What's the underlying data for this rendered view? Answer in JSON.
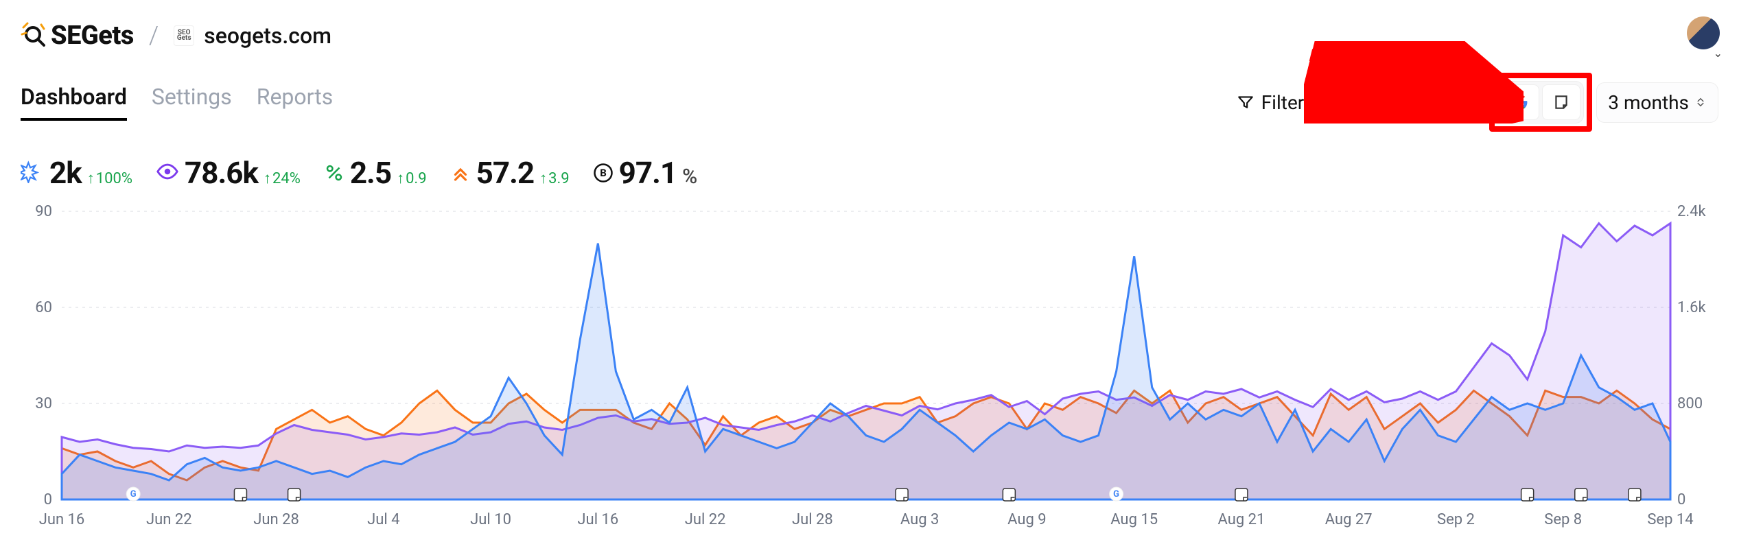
{
  "brand": {
    "name": "SEO Gets"
  },
  "site": {
    "domain": "seogets.com"
  },
  "tabs": [
    {
      "id": "dashboard",
      "label": "Dashboard",
      "active": true
    },
    {
      "id": "settings",
      "label": "Settings",
      "active": false
    },
    {
      "id": "reports",
      "label": "Reports",
      "active": false
    }
  ],
  "toolbar": {
    "filter_label": "Filter",
    "date_range": "3 months"
  },
  "stats": {
    "clicks": {
      "icon": "clicks",
      "value": "2k",
      "delta": "100%",
      "direction": "up"
    },
    "impressions": {
      "icon": "impressions",
      "value": "78.6k",
      "delta": "24%",
      "direction": "up"
    },
    "ctr": {
      "icon": "ctr",
      "value": "2.5",
      "delta": "0.9",
      "direction": "up"
    },
    "position": {
      "icon": "position",
      "value": "57.2",
      "delta": "3.9",
      "direction": "up"
    },
    "brand": {
      "icon": "brand",
      "value": "97.1",
      "suffix": "%"
    }
  },
  "annotations": {
    "highlight_group": "source-icons",
    "arrow_target": "source-icons"
  },
  "chart_data": {
    "type": "line",
    "xlabel": "",
    "ylabel_left": "",
    "ylabel_right": "",
    "ylim_left": [
      0,
      90
    ],
    "ylim_right": [
      0,
      2400
    ],
    "left_ticks": [
      0,
      30,
      60,
      90
    ],
    "right_ticks": [
      0,
      800,
      1600,
      2400
    ],
    "right_tick_labels": [
      "0",
      "800",
      "1.6k",
      "2.4k"
    ],
    "x_dates": [
      "Jun 16",
      "Jun 17",
      "Jun 18",
      "Jun 19",
      "Jun 20",
      "Jun 21",
      "Jun 22",
      "Jun 23",
      "Jun 24",
      "Jun 25",
      "Jun 26",
      "Jun 27",
      "Jun 28",
      "Jun 29",
      "Jun 30",
      "Jul 1",
      "Jul 2",
      "Jul 3",
      "Jul 4",
      "Jul 5",
      "Jul 6",
      "Jul 7",
      "Jul 8",
      "Jul 9",
      "Jul 10",
      "Jul 11",
      "Jul 12",
      "Jul 13",
      "Jul 14",
      "Jul 15",
      "Jul 16",
      "Jul 17",
      "Jul 18",
      "Jul 19",
      "Jul 20",
      "Jul 21",
      "Jul 22",
      "Jul 23",
      "Jul 24",
      "Jul 25",
      "Jul 26",
      "Jul 27",
      "Jul 28",
      "Jul 29",
      "Jul 30",
      "Jul 31",
      "Aug 1",
      "Aug 2",
      "Aug 3",
      "Aug 4",
      "Aug 5",
      "Aug 6",
      "Aug 7",
      "Aug 8",
      "Aug 9",
      "Aug 10",
      "Aug 11",
      "Aug 12",
      "Aug 13",
      "Aug 14",
      "Aug 15",
      "Aug 16",
      "Aug 17",
      "Aug 18",
      "Aug 19",
      "Aug 20",
      "Aug 21",
      "Aug 22",
      "Aug 23",
      "Aug 24",
      "Aug 25",
      "Aug 26",
      "Aug 27",
      "Aug 28",
      "Aug 29",
      "Aug 30",
      "Aug 31",
      "Sep 1",
      "Sep 2",
      "Sep 3",
      "Sep 4",
      "Sep 5",
      "Sep 6",
      "Sep 7",
      "Sep 8",
      "Sep 9",
      "Sep 10",
      "Sep 11",
      "Sep 12",
      "Sep 13",
      "Sep 14"
    ],
    "x_tick_labels": [
      "Jun 16",
      "Jun 22",
      "Jun 28",
      "Jul 4",
      "Jul 10",
      "Jul 16",
      "Jul 22",
      "Jul 28",
      "Aug 3",
      "Aug 9",
      "Aug 15",
      "Aug 21",
      "Aug 27",
      "Sep 2",
      "Sep 8",
      "Sep 14"
    ],
    "x_tick_idx": [
      0,
      6,
      12,
      18,
      24,
      30,
      36,
      42,
      48,
      54,
      60,
      66,
      72,
      78,
      84,
      90
    ],
    "series": [
      {
        "name": "clicks",
        "axis": "left",
        "color": "#3b82f6",
        "values": [
          8,
          14,
          12,
          10,
          9,
          8,
          6,
          11,
          13,
          10,
          9,
          10,
          12,
          10,
          8,
          9,
          7,
          10,
          12,
          11,
          14,
          16,
          18,
          22,
          26,
          38,
          30,
          20,
          14,
          50,
          80,
          40,
          25,
          28,
          24,
          35,
          15,
          22,
          20,
          18,
          16,
          18,
          24,
          30,
          26,
          20,
          18,
          22,
          28,
          24,
          20,
          15,
          20,
          24,
          22,
          25,
          20,
          18,
          20,
          40,
          76,
          35,
          25,
          30,
          25,
          28,
          26,
          30,
          18,
          28,
          15,
          22,
          18,
          25,
          12,
          22,
          28,
          20,
          18,
          25,
          32,
          28,
          30,
          28,
          30,
          45,
          35,
          32,
          28,
          30,
          18
        ]
      },
      {
        "name": "impressions",
        "axis": "right",
        "color": "#8b5cf6",
        "values": [
          520,
          480,
          500,
          460,
          430,
          420,
          400,
          450,
          430,
          440,
          430,
          450,
          550,
          620,
          580,
          560,
          540,
          500,
          520,
          550,
          540,
          560,
          600,
          540,
          560,
          630,
          650,
          600,
          580,
          620,
          680,
          700,
          650,
          670,
          630,
          640,
          680,
          620,
          600,
          580,
          620,
          650,
          700,
          650,
          720,
          780,
          740,
          700,
          780,
          750,
          800,
          830,
          870,
          770,
          820,
          710,
          840,
          880,
          900,
          830,
          850,
          780,
          870,
          830,
          900,
          880,
          920,
          850,
          900,
          830,
          770,
          920,
          830,
          900,
          810,
          840,
          900,
          830,
          900,
          1100,
          1300,
          1200,
          1000,
          1400,
          2200,
          2100,
          2300,
          2150,
          2280,
          2200,
          2300
        ]
      },
      {
        "name": "ctr_scaled",
        "axis": "left",
        "color": "#f97316",
        "values": [
          16,
          14,
          15,
          12,
          10,
          12,
          8,
          6,
          10,
          12,
          10,
          9,
          22,
          25,
          28,
          24,
          26,
          22,
          20,
          24,
          30,
          34,
          28,
          24,
          24,
          30,
          33,
          28,
          24,
          28,
          28,
          28,
          24,
          22,
          30,
          25,
          17,
          26,
          20,
          24,
          26,
          22,
          24,
          28,
          26,
          28,
          30,
          30,
          32,
          24,
          26,
          30,
          32,
          30,
          22,
          30,
          28,
          32,
          30,
          27,
          34,
          30,
          34,
          24,
          30,
          32,
          28,
          30,
          32,
          26,
          20,
          33,
          28,
          32,
          22,
          26,
          30,
          24,
          28,
          34,
          30,
          26,
          20,
          34,
          32,
          32,
          30,
          34,
          30,
          25,
          22
        ]
      }
    ],
    "markers": [
      {
        "date_idx": 4,
        "type": "google"
      },
      {
        "date_idx": 10,
        "type": "note"
      },
      {
        "date_idx": 13,
        "type": "note"
      },
      {
        "date_idx": 47,
        "type": "note"
      },
      {
        "date_idx": 53,
        "type": "note"
      },
      {
        "date_idx": 59,
        "type": "google"
      },
      {
        "date_idx": 66,
        "type": "note"
      },
      {
        "date_idx": 82,
        "type": "note"
      },
      {
        "date_idx": 85,
        "type": "note"
      },
      {
        "date_idx": 88,
        "type": "note"
      }
    ]
  }
}
